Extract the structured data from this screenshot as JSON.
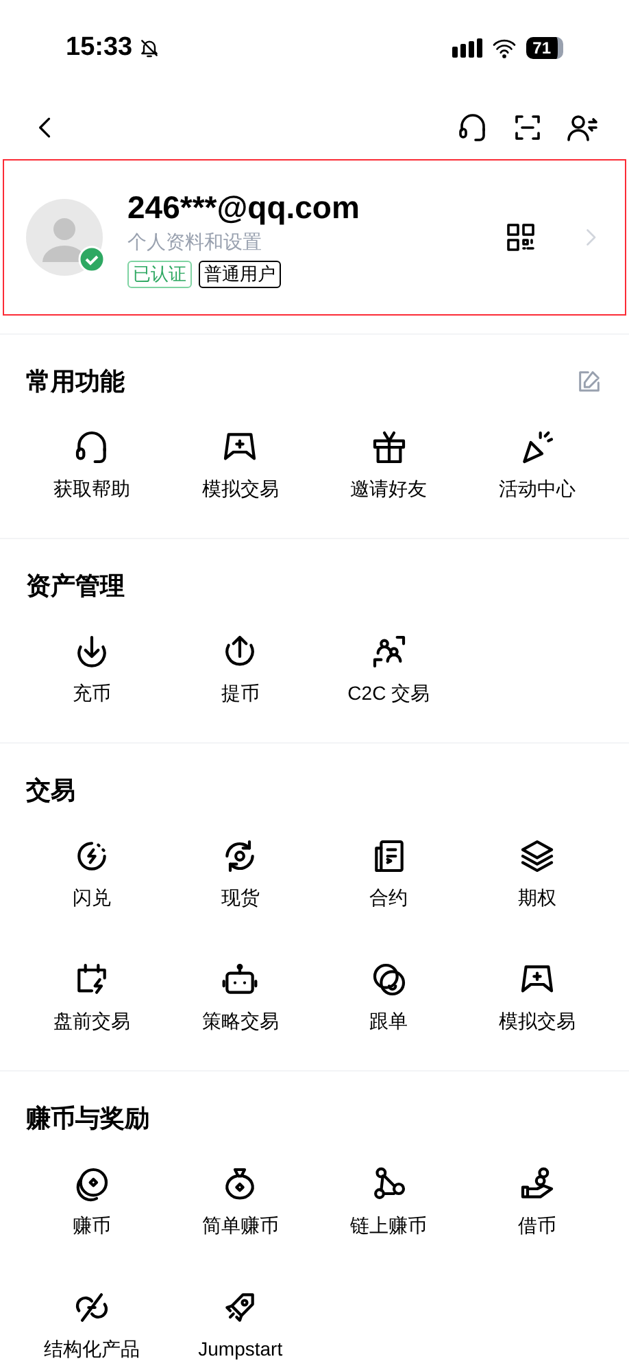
{
  "status_bar": {
    "time": "15:33",
    "battery": "71"
  },
  "profile": {
    "email": "246***@qq.com",
    "subtitle": "个人资料和设置",
    "verified_badge": "已认证",
    "user_badge": "普通用户",
    "highlighted": true
  },
  "sections": [
    {
      "title": "常用功能",
      "editable": true,
      "items": [
        {
          "label": "获取帮助"
        },
        {
          "label": "模拟交易"
        },
        {
          "label": "邀请好友"
        },
        {
          "label": "活动中心"
        }
      ]
    },
    {
      "title": "资产管理",
      "editable": false,
      "items": [
        {
          "label": "充币"
        },
        {
          "label": "提币"
        },
        {
          "label": "C2C 交易"
        }
      ]
    },
    {
      "title": "交易",
      "editable": false,
      "items": [
        {
          "label": "闪兑"
        },
        {
          "label": "现货"
        },
        {
          "label": "合约"
        },
        {
          "label": "期权"
        },
        {
          "label": "盘前交易"
        },
        {
          "label": "策略交易"
        },
        {
          "label": "跟单"
        },
        {
          "label": "模拟交易"
        }
      ]
    },
    {
      "title": "赚币与奖励",
      "editable": false,
      "items": [
        {
          "label": "赚币"
        },
        {
          "label": "简单赚币"
        },
        {
          "label": "链上赚币"
        },
        {
          "label": "借币"
        },
        {
          "label": "结构化产品"
        },
        {
          "label": "Jumpstart"
        }
      ]
    }
  ]
}
